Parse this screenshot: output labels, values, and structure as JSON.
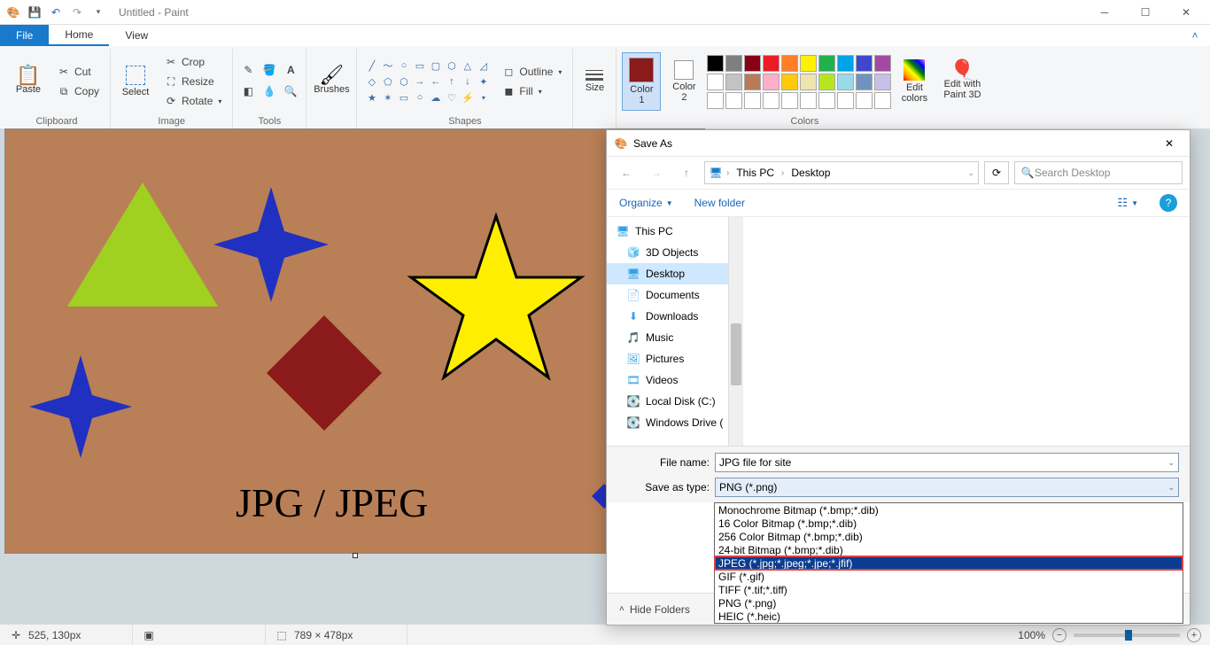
{
  "title": "Untitled - Paint",
  "tabs": {
    "file": "File",
    "home": "Home",
    "view": "View"
  },
  "ribbon": {
    "clipboard": {
      "label": "Clipboard",
      "paste": "Paste",
      "cut": "Cut",
      "copy": "Copy"
    },
    "image": {
      "label": "Image",
      "select": "Select",
      "crop": "Crop",
      "resize": "Resize",
      "rotate": "Rotate"
    },
    "tools": {
      "label": "Tools"
    },
    "brushes": {
      "label": "Brushes"
    },
    "shapes": {
      "label": "Shapes",
      "outline": "Outline",
      "fill": "Fill"
    },
    "size": {
      "label": "Size"
    },
    "colors": {
      "label": "Colors",
      "color1": "Color\n1",
      "color2": "Color\n2",
      "edit": "Edit\ncolors",
      "paint3d": "Edit with\nPaint 3D"
    },
    "color1_value": "#8b1a1a",
    "color2_value": "#ffffff",
    "palette_row1": [
      "#000000",
      "#7f7f7f",
      "#880015",
      "#ed1c24",
      "#ff7f27",
      "#fff200",
      "#22b14c",
      "#00a2e8",
      "#3f48cc",
      "#a349a4"
    ],
    "palette_row2": [
      "#ffffff",
      "#c3c3c3",
      "#b97a57",
      "#ffaec9",
      "#ffc90e",
      "#efe4b0",
      "#b5e61d",
      "#99d9ea",
      "#7092be",
      "#c8bfe7"
    ],
    "palette_row3": [
      "#ffffff",
      "#ffffff",
      "#ffffff",
      "#ffffff",
      "#ffffff",
      "#ffffff",
      "#ffffff",
      "#ffffff",
      "#ffffff",
      "#ffffff"
    ]
  },
  "canvas_text": "JPG / JPEG",
  "saveas": {
    "title": "Save As",
    "breadcrumb": [
      "This PC",
      "Desktop"
    ],
    "search_placeholder": "Search Desktop",
    "organize": "Organize",
    "newfolder": "New folder",
    "tree": [
      {
        "label": "This PC",
        "icon": "pc"
      },
      {
        "label": "3D Objects",
        "icon": "3d"
      },
      {
        "label": "Desktop",
        "icon": "desktop",
        "selected": true
      },
      {
        "label": "Documents",
        "icon": "doc"
      },
      {
        "label": "Downloads",
        "icon": "dl"
      },
      {
        "label": "Music",
        "icon": "music"
      },
      {
        "label": "Pictures",
        "icon": "pic"
      },
      {
        "label": "Videos",
        "icon": "vid"
      },
      {
        "label": "Local Disk (C:)",
        "icon": "disk"
      },
      {
        "label": "Windows Drive (",
        "icon": "disk"
      }
    ],
    "filename_label": "File name:",
    "filename_value": "JPG file for site",
    "type_label": "Save as type:",
    "type_selected": "PNG (*.png)",
    "type_options": [
      "Monochrome Bitmap (*.bmp;*.dib)",
      "16 Color Bitmap (*.bmp;*.dib)",
      "256 Color Bitmap (*.bmp;*.dib)",
      "24-bit Bitmap (*.bmp;*.dib)",
      "JPEG (*.jpg;*.jpeg;*.jpe;*.jfif)",
      "GIF (*.gif)",
      "TIFF (*.tif;*.tiff)",
      "PNG (*.png)",
      "HEIC (*.heic)"
    ],
    "highlighted_index": 4,
    "hide_folders": "Hide Folders"
  },
  "status": {
    "cursor": "525, 130px",
    "canvas": "789 × 478px",
    "zoom": "100%"
  }
}
